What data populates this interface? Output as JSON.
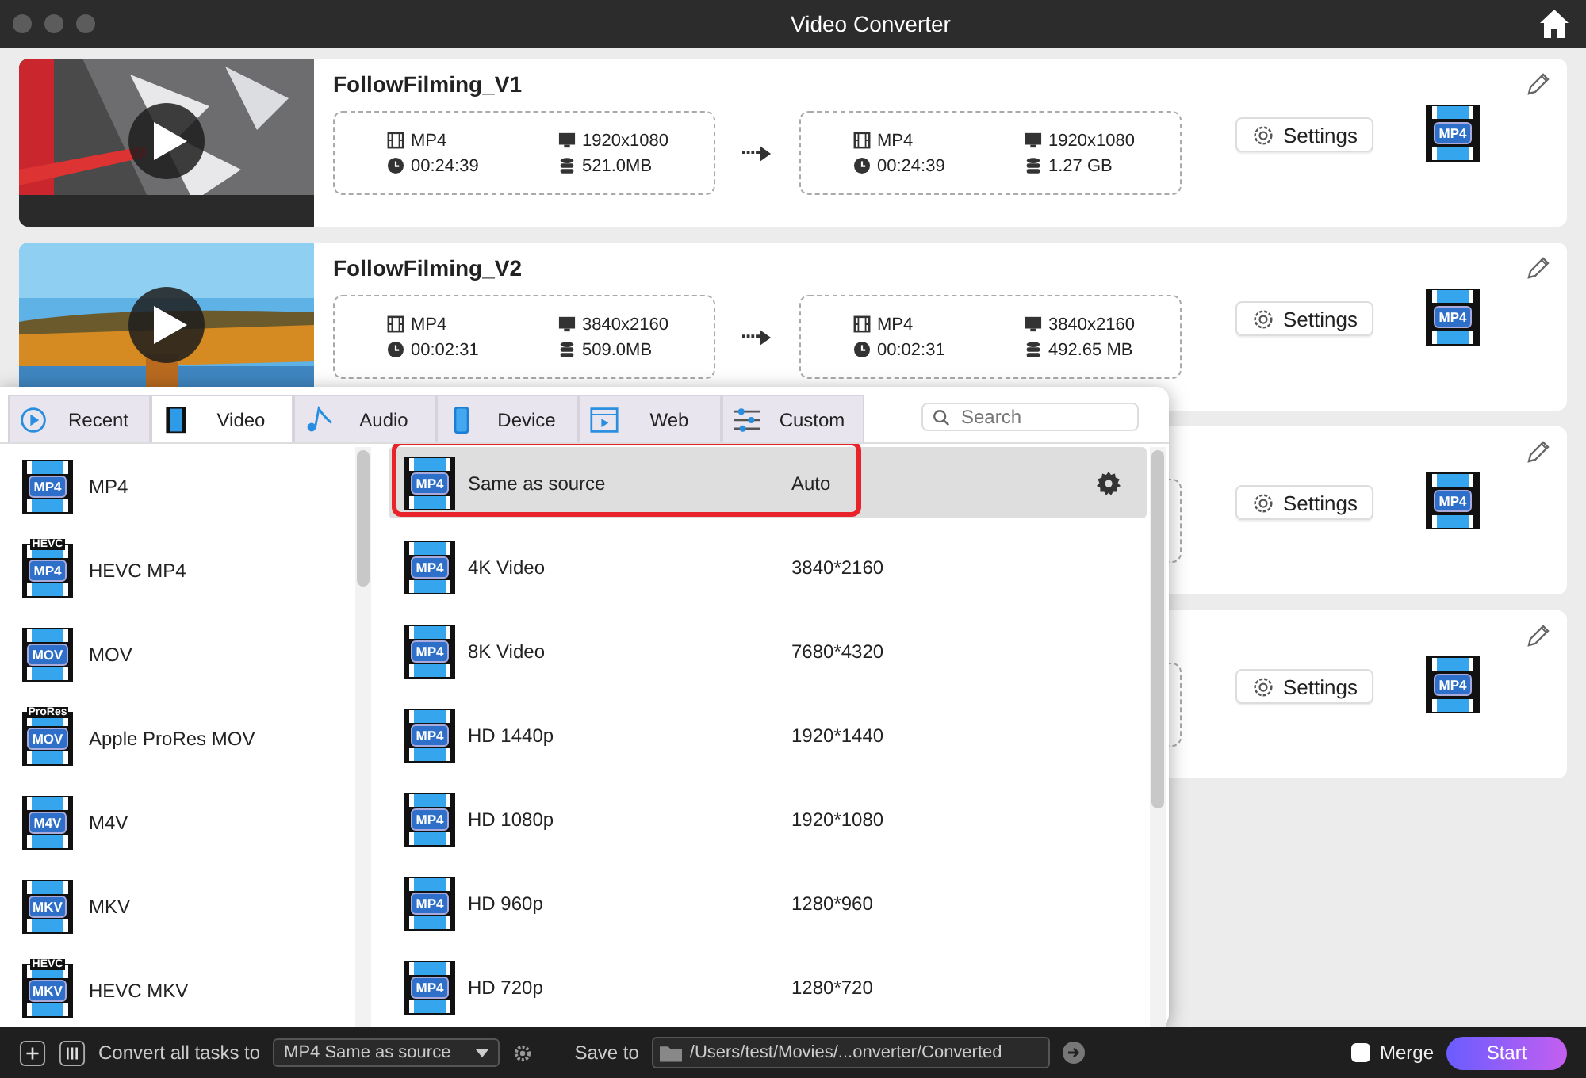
{
  "window": {
    "title": "Video Converter"
  },
  "tasks": [
    {
      "name": "FollowFilming_V1",
      "source": {
        "format": "MP4",
        "resolution": "1920x1080",
        "duration": "00:24:39",
        "size": "521.0MB"
      },
      "output": {
        "format": "MP4",
        "resolution": "1920x1080",
        "duration": "00:24:39",
        "size": "1.27 GB"
      },
      "settings": "Settings",
      "target_badge": "MP4"
    },
    {
      "name": "FollowFilming_V2",
      "source": {
        "format": "MP4",
        "resolution": "3840x2160",
        "duration": "00:02:31",
        "size": "509.0MB"
      },
      "output": {
        "format": "MP4",
        "resolution": "3840x2160",
        "duration": "00:02:31",
        "size": "492.65 MB"
      },
      "settings": "Settings",
      "target_badge": "MP4"
    },
    {
      "settings": "Settings",
      "target_badge": "MP4"
    },
    {
      "settings": "Settings",
      "target_badge": "MP4"
    }
  ],
  "format_panel": {
    "tabs": [
      {
        "label": "Recent",
        "kind": "recent",
        "selected": false
      },
      {
        "label": "Video",
        "kind": "video",
        "selected": true
      },
      {
        "label": "Audio",
        "kind": "audio",
        "selected": false
      },
      {
        "label": "Device",
        "kind": "device",
        "selected": false
      },
      {
        "label": "Web",
        "kind": "web",
        "selected": false
      },
      {
        "label": "Custom",
        "kind": "custom",
        "selected": false
      }
    ],
    "search": {
      "placeholder": "Search"
    },
    "formats": [
      {
        "label": "MP4",
        "badge": "MP4"
      },
      {
        "label": "HEVC MP4",
        "badge": "MP4",
        "badge_top": "HEVC"
      },
      {
        "label": "MOV",
        "badge": "MOV"
      },
      {
        "label": "Apple ProRes MOV",
        "badge": "MOV",
        "badge_top": "ProRes"
      },
      {
        "label": "M4V",
        "badge": "M4V"
      },
      {
        "label": "MKV",
        "badge": "MKV"
      },
      {
        "label": "HEVC MKV",
        "badge": "MKV",
        "badge_top": "HEVC"
      }
    ],
    "presets": [
      {
        "badge": "MP4",
        "name": "Same as source",
        "resolution": "Auto",
        "selected": true
      },
      {
        "badge": "MP4",
        "name": "4K Video",
        "resolution": "3840*2160",
        "selected": false
      },
      {
        "badge": "MP4",
        "name": "8K Video",
        "resolution": "7680*4320",
        "selected": false
      },
      {
        "badge": "MP4",
        "name": "HD 1440p",
        "resolution": "1920*1440",
        "selected": false
      },
      {
        "badge": "MP4",
        "name": "HD 1080p",
        "resolution": "1920*1080",
        "selected": false
      },
      {
        "badge": "MP4",
        "name": "HD 960p",
        "resolution": "1280*960",
        "selected": false
      },
      {
        "badge": "MP4",
        "name": "HD 720p",
        "resolution": "1280*720",
        "selected": false
      }
    ]
  },
  "bottom_bar": {
    "convert_label": "Convert all tasks to",
    "convert_value": "MP4 Same as source",
    "save_label": "Save to",
    "save_path": "/Users/test/Movies/...onverter/Converted",
    "merge": {
      "label": "Merge",
      "checked": false
    },
    "start": "Start"
  }
}
